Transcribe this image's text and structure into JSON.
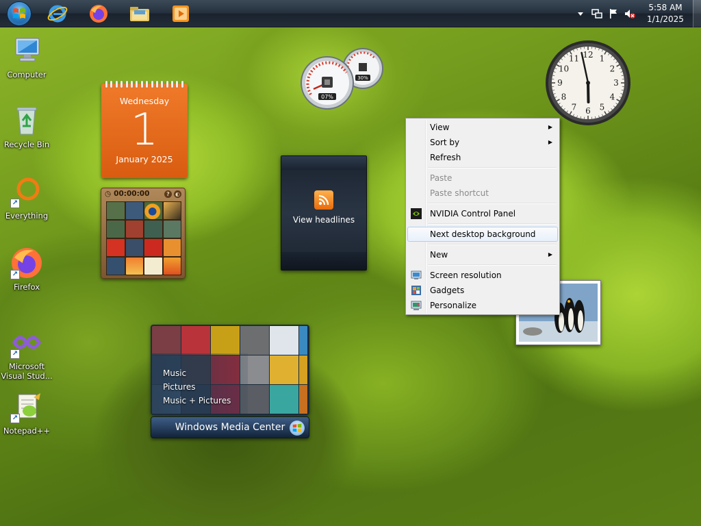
{
  "taskbar": {
    "start_icon": "windows-logo",
    "pinned": [
      {
        "name": "internet-explorer",
        "icon": "internet-explorer-icon"
      },
      {
        "name": "firefox",
        "icon": "firefox-icon"
      },
      {
        "name": "windows-explorer",
        "icon": "folder-icon"
      },
      {
        "name": "media-player",
        "icon": "media-player-icon"
      }
    ],
    "tray": {
      "icons": [
        "show-hidden-icons-arrow",
        "network-icon",
        "action-center-flag-icon",
        "volume-muted-icon"
      ],
      "time": "5:58 AM",
      "date": "1/1/2025"
    }
  },
  "desktop_icons": [
    {
      "label": "Computer",
      "icon": "computer-icon"
    },
    {
      "label": "Recycle Bin",
      "icon": "recycle-bin-icon"
    },
    {
      "label": "Everything",
      "icon": "everything-icon"
    },
    {
      "label": "Firefox",
      "icon": "firefox-icon"
    },
    {
      "label": "Microsoft Visual Stud...",
      "icon": "visual-studio-icon"
    },
    {
      "label": "Notepad++",
      "icon": "notepad-plus-plus-icon"
    }
  ],
  "gadgets": {
    "calendar": {
      "weekday": "Wednesday",
      "day": "1",
      "month_year": "January 2025"
    },
    "puzzle": {
      "timer": "00:00:00"
    },
    "cpu_meter": {
      "cpu": "07%",
      "memory": "30%"
    },
    "feed": {
      "label": "View headlines"
    },
    "clock": {
      "hour": 5,
      "minute": 58
    },
    "media_center": {
      "items": [
        "Music",
        "Pictures",
        "Music + Pictures"
      ],
      "title": "Windows Media Center"
    }
  },
  "context_menu": {
    "groups": [
      [
        {
          "label": "View",
          "submenu": true
        },
        {
          "label": "Sort by",
          "submenu": true
        },
        {
          "label": "Refresh"
        }
      ],
      [
        {
          "label": "Paste",
          "disabled": true
        },
        {
          "label": "Paste shortcut",
          "disabled": true
        }
      ],
      [
        {
          "label": "NVIDIA Control Panel",
          "icon": "nvidia-icon"
        }
      ],
      [
        {
          "label": "Next desktop background",
          "highlighted": true
        }
      ],
      [
        {
          "label": "New",
          "submenu": true
        }
      ],
      [
        {
          "label": "Screen resolution",
          "icon": "screen-resolution-icon"
        },
        {
          "label": "Gadgets",
          "icon": "gadgets-icon"
        },
        {
          "label": "Personalize",
          "icon": "personalize-icon"
        }
      ]
    ],
    "submenu_arrow": "▶"
  },
  "colors": {
    "calendar": "#e56a1c",
    "menu_highlight_border": "#aecff7",
    "wallpaper_green": "#8fbc27"
  }
}
